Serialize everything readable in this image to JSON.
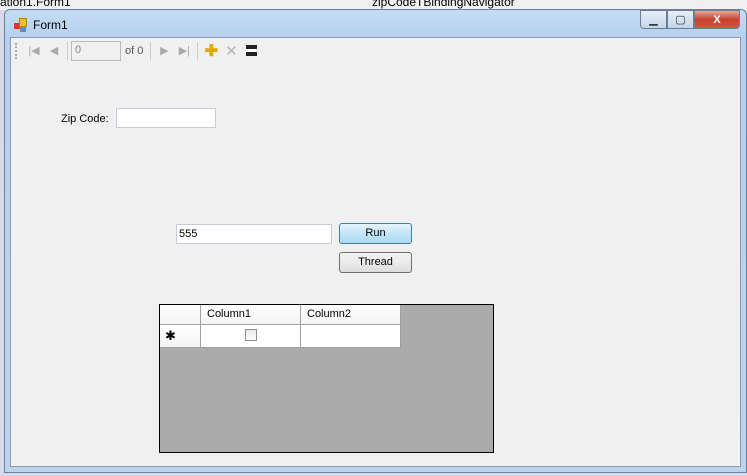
{
  "background": {
    "left_text": "ation1.Form1",
    "right_text": "zipCodeTBindingNavigator"
  },
  "window": {
    "title": "Form1",
    "minimize": "▁",
    "maximize": "▢",
    "close": "X"
  },
  "navigator": {
    "position": "0",
    "count_label": "of 0",
    "icons": [
      "move-first-icon",
      "move-previous-icon",
      "move-next-icon",
      "move-last-icon",
      "add-new-icon",
      "delete-icon",
      "save-icon"
    ]
  },
  "form": {
    "zip_label": "Zip Code:",
    "zip_value": "",
    "input_value": "555",
    "run_label": "Run",
    "thread_label": "Thread"
  },
  "grid": {
    "columns": [
      "Column1",
      "Column2"
    ],
    "new_row_marker": "✱"
  }
}
